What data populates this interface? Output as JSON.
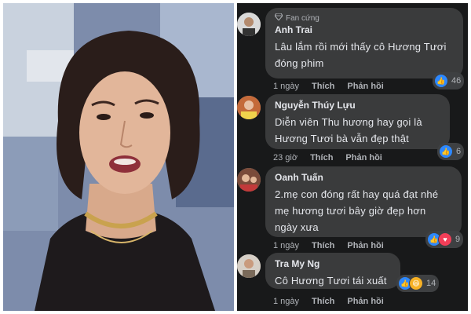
{
  "photo": {
    "alt_icon": "portrait-photo"
  },
  "comments": [
    {
      "badge": "Fan cứng",
      "name": "Anh Trai",
      "text_lines": [
        "Lâu lắm rồi mới thấy cô Hương Tươi",
        "đóng phim"
      ],
      "time": "1 ngày",
      "like_label": "Thích",
      "reply_label": "Phản hồi",
      "reaction_icons": [
        "like-icon"
      ],
      "reaction_count": "46"
    },
    {
      "name": "Nguyễn Thúy Lựu",
      "text_lines": [
        "Diễn viên Thu hương hay gọi là",
        "Hương Tươi bà vẫn đẹp thật"
      ],
      "time": "23 giờ",
      "like_label": "Thích",
      "reply_label": "Phản hồi",
      "reaction_icons": [
        "like-icon"
      ],
      "reaction_count": "6"
    },
    {
      "name": "Oanh Tuấn",
      "text_lines": [
        "2.mẹ con đóng rất hay quá đạt nhé",
        "mẹ hương tươi bây giờ đẹp hơn",
        "ngày xưa"
      ],
      "time": "1 ngày",
      "like_label": "Thích",
      "reply_label": "Phản hồi",
      "reaction_icons": [
        "like-icon",
        "love-icon"
      ],
      "reaction_count": "9"
    },
    {
      "name": "Tra My Ng",
      "text_lines": [
        "Cô Hương Tươi tái xuất"
      ],
      "time": "1 ngày",
      "like_label": "Thích",
      "reply_label": "Phản hồi",
      "reaction_icons": [
        "like-icon",
        "haha-icon"
      ],
      "reaction_count": "14"
    }
  ],
  "colors": {
    "panel_bg": "#18191a",
    "bubble_bg": "#3a3b3c",
    "like_blue": "#2d88ff",
    "love_red": "#f33e58",
    "haha_yellow": "#f7b125"
  }
}
